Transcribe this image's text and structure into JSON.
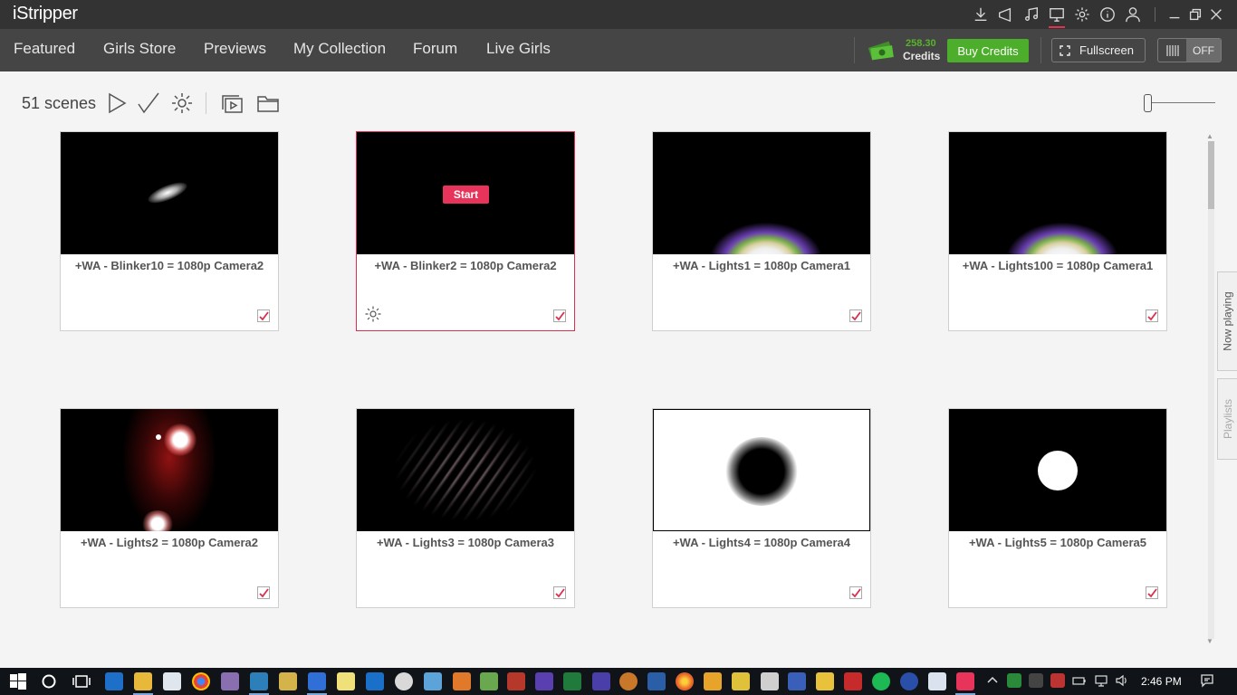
{
  "app": {
    "logo": "iStripper"
  },
  "nav": {
    "items": [
      "Featured",
      "Girls Store",
      "Previews",
      "My Collection",
      "Forum",
      "Live Girls"
    ],
    "credits_amount": "258.30",
    "credits_label": "Credits",
    "buy_label": "Buy Credits",
    "fullscreen_label": "Fullscreen",
    "toggle_label": "OFF"
  },
  "toolbar": {
    "scene_count": "51 scenes"
  },
  "cards": [
    {
      "title": "+WA - Blinker10 = 1080p Camera2",
      "checked": true
    },
    {
      "title": "+WA - Blinker2 = 1080p Camera2",
      "checked": true,
      "selected": true,
      "action": "Start"
    },
    {
      "title": "+WA - Lights1 = 1080p Camera1",
      "checked": true
    },
    {
      "title": "+WA - Lights100 = 1080p Camera1",
      "checked": true
    },
    {
      "title": "+WA - Lights2 = 1080p Camera2",
      "checked": true
    },
    {
      "title": "+WA - Lights3 = 1080p Camera3",
      "checked": true
    },
    {
      "title": "+WA - Lights4 = 1080p Camera4",
      "checked": true
    },
    {
      "title": "+WA - Lights5 = 1080p Camera5",
      "checked": true
    }
  ],
  "side_tabs": {
    "now_playing": "Now playing",
    "playlists": "Playlists"
  },
  "taskbar": {
    "time": "2:46 PM"
  },
  "colors": {
    "accent": "#e8345a",
    "credits_green": "#58b32c",
    "buy_green": "#4cae2b"
  }
}
